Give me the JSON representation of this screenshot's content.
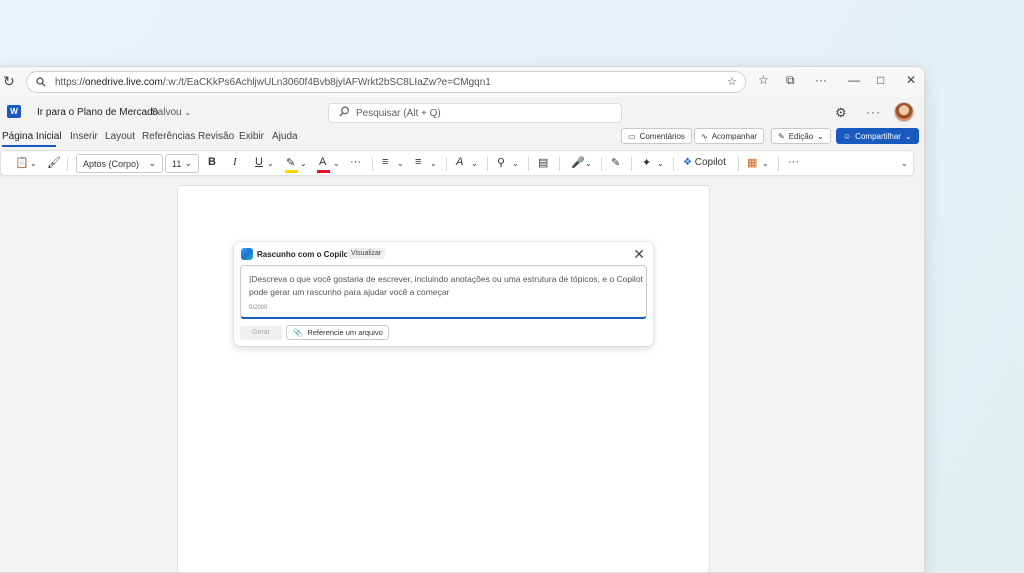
{
  "browser": {
    "url_prefix": "https://",
    "url_host": "onedrive.live.com",
    "url_rest": "/:w:/t/EaCKkPs6AchljwULn3060f4Bvb8jylAFWrkt2bSC8LIaZw?e=CMgqn1"
  },
  "word": {
    "logo": "W",
    "doc_title": "Ir para o Plano de Mercado",
    "doc_status": "Salvou",
    "search_placeholder": "Pesquisar (Alt + Q)"
  },
  "tabs": [
    "Página Inicial",
    "Inserir",
    "Layout",
    "Referências",
    "Revisão",
    "Exibir",
    "Ajuda"
  ],
  "actions": {
    "comments": "Comentários",
    "follow": "Acompanhar",
    "editing": "Edição",
    "share": "Compartilhar"
  },
  "ribbon": {
    "font_name": "Aptos (Corpo)",
    "font_size": "11",
    "bold": "B",
    "italic": "I",
    "underline": "U",
    "font_color": "A",
    "copilot": "Copilot",
    "more": "···"
  },
  "copilot_panel": {
    "title": "Rascunho com o Copilot",
    "badge": "Visualizar",
    "prompt": "|Descreva o que você gostaria de escrever, incluindo anotações ou uma estrutura de tópicos, e o Copilot pode gerar um rascunho para ajudar você a começar",
    "counter": "0/2000",
    "generate_label": "Gerar",
    "reference_label": "Referencie um arquivo"
  },
  "colors": {
    "accent": "#185abd",
    "highlight_bar": "#ffd700",
    "font_color_bar": "#e81123"
  }
}
